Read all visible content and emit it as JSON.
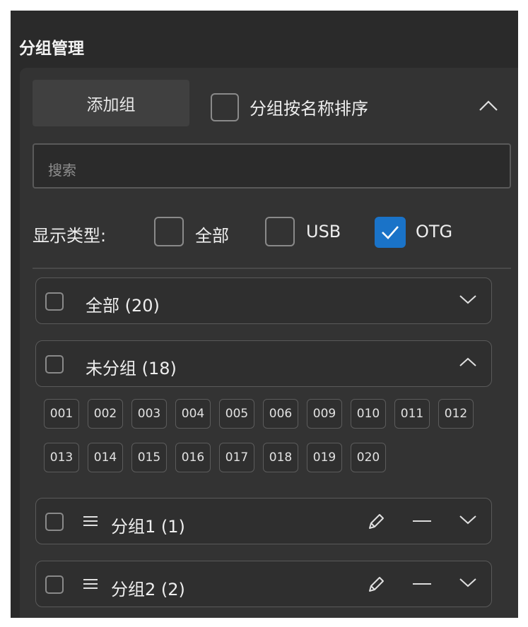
{
  "title": "分组管理",
  "toolbar": {
    "add_group_label": "添加组",
    "sort_by_name_label": "分组按名称排序",
    "sort_by_name_checked": false
  },
  "search": {
    "placeholder": "搜索",
    "value": ""
  },
  "filter": {
    "label": "显示类型:",
    "options": [
      {
        "label": "全部",
        "checked": false
      },
      {
        "label": "USB",
        "checked": false
      },
      {
        "label": "OTG",
        "checked": true
      }
    ]
  },
  "groups": [
    {
      "label": "全部 (20)",
      "expanded": false,
      "editable": false
    },
    {
      "label": "未分组 (18)",
      "expanded": true,
      "editable": false,
      "devices": [
        "001",
        "002",
        "003",
        "004",
        "005",
        "006",
        "009",
        "010",
        "011",
        "012",
        "013",
        "014",
        "015",
        "016",
        "017",
        "018",
        "019",
        "020"
      ]
    },
    {
      "label": "分组1 (1)",
      "expanded": false,
      "editable": true
    },
    {
      "label": "分组2 (2)",
      "expanded": false,
      "editable": true
    }
  ],
  "colors": {
    "background": "#2a2a2a",
    "panel": "#333333",
    "accent": "#1a73c8"
  },
  "icons": {
    "collapse": "chevron-up-icon",
    "expand": "chevron-down-icon",
    "drag": "drag-handle-icon",
    "edit": "pencil-icon",
    "remove": "minus-icon",
    "check": "checkmark-icon"
  }
}
